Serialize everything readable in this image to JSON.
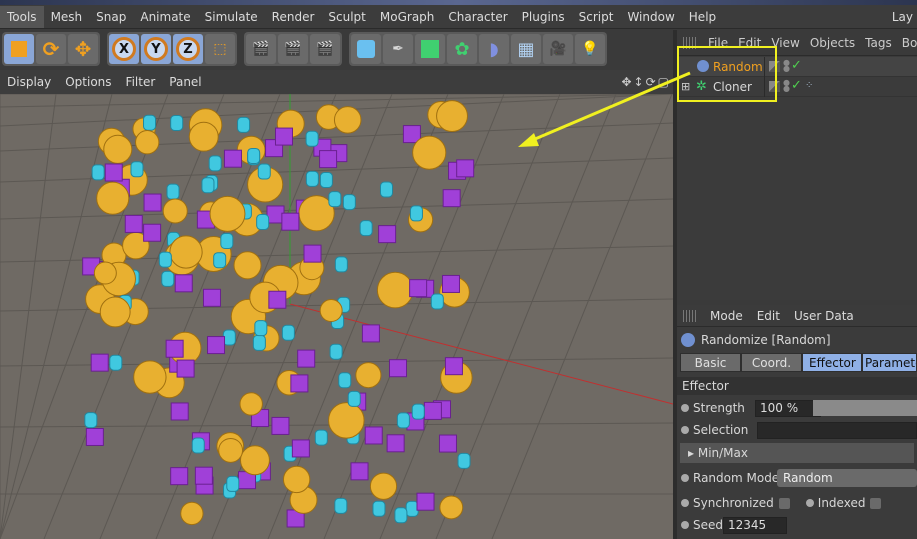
{
  "menubar": {
    "items": [
      "Tools",
      "Mesh",
      "Snap",
      "Animate",
      "Simulate",
      "Render",
      "Sculpt",
      "MoGraph",
      "Character",
      "Plugins",
      "Script",
      "Window",
      "Help"
    ],
    "right": "Lay"
  },
  "toolbar": {
    "axes": [
      "X",
      "Y",
      "Z"
    ]
  },
  "viewport_menu": {
    "items": [
      "Display",
      "Options",
      "Filter",
      "Panel"
    ],
    "nav_icons": "✥↕⟳▢"
  },
  "object_manager": {
    "menu": [
      "File",
      "Edit",
      "View",
      "Objects",
      "Tags",
      "Boo"
    ],
    "objects": [
      {
        "name": "Random",
        "color": "#f0a020",
        "check": "✓"
      },
      {
        "name": "Cloner",
        "color": "#e0e0e0",
        "check": "✓",
        "expand": "⊞"
      }
    ]
  },
  "attribute_manager": {
    "menu": [
      "Mode",
      "Edit",
      "User Data"
    ],
    "title": "Randomize [Random]",
    "tabs": [
      "Basic",
      "Coord.",
      "Effector",
      "Paramete"
    ],
    "active_tab": "Effector",
    "section": "Effector",
    "strength_label": "Strength",
    "strength_value": "100 %",
    "strength_percent": 100,
    "selection_label": "Selection",
    "minmax_label": "Min/Max",
    "random_mode_label": "Random Mode",
    "random_mode_value": "Random",
    "synchronized_label": "Synchronized",
    "indexed_label": "Indexed",
    "seed_label": "Seed",
    "seed_value": "12345"
  }
}
